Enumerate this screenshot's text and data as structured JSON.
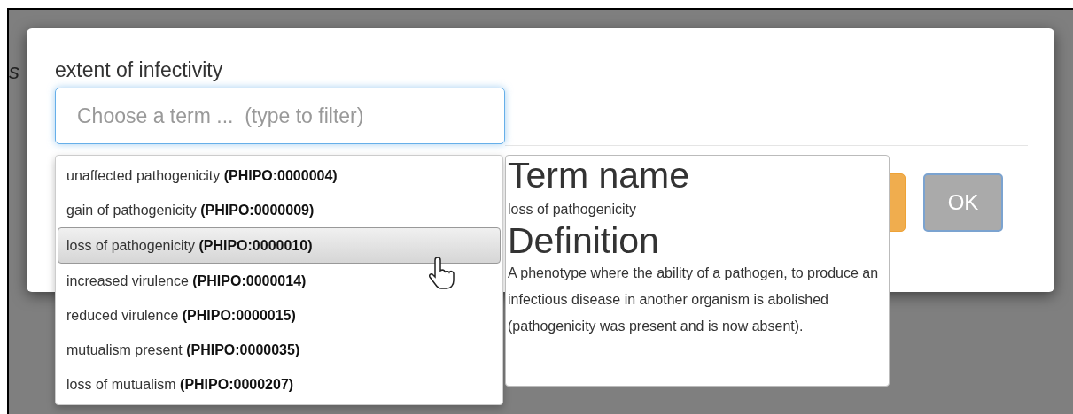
{
  "background_text": "s",
  "dialog": {
    "label": "extent of infectivity",
    "input": {
      "placeholder": "Choose a term ...  (type to filter)"
    },
    "buttons": [
      {
        "kind": "warning"
      },
      {
        "kind": "default",
        "label": "OK"
      }
    ]
  },
  "dropdown": {
    "items": [
      {
        "name": "unaffected pathogenicity",
        "id": "(PHIPO:0000004)",
        "selected": false
      },
      {
        "name": "gain of pathogenicity",
        "id": "(PHIPO:0000009)",
        "selected": false
      },
      {
        "name": "loss of pathogenicity",
        "id": "(PHIPO:0000010)",
        "selected": true
      },
      {
        "name": "increased virulence",
        "id": "(PHIPO:0000014)",
        "selected": false
      },
      {
        "name": "reduced virulence",
        "id": "(PHIPO:0000015)",
        "selected": false
      },
      {
        "name": "mutualism present",
        "id": "(PHIPO:0000035)",
        "selected": false
      },
      {
        "name": "loss of mutualism",
        "id": "(PHIPO:0000207)",
        "selected": false
      }
    ]
  },
  "term_popup": {
    "name_heading": "Term name",
    "name": "loss of pathogenicity",
    "definition_heading": "Definition",
    "definition": "A phenotype where the ability of a pathogen, to produce an infectious disease in another organism is abolished (pathogenicity was present and is now absent)."
  }
}
